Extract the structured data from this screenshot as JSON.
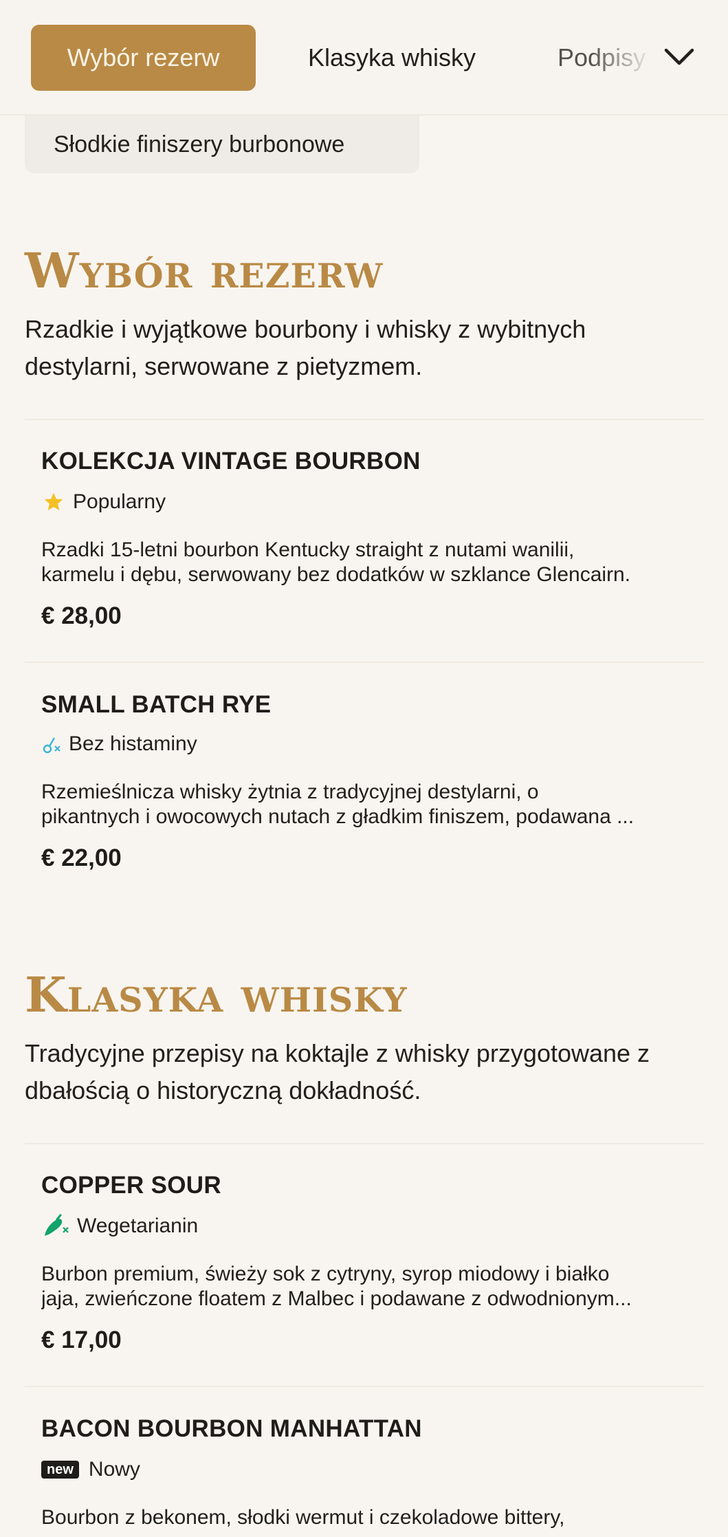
{
  "nav": {
    "tabs": [
      {
        "label": "Wybór rezerw",
        "active": true
      },
      {
        "label": "Klasyka whisky",
        "active": false
      },
      {
        "label": "Podpisy",
        "active": false
      }
    ],
    "more_icon": "chevron-down-icon"
  },
  "filter_chip": {
    "label": "Słodkie finiszery burbonowe"
  },
  "sections": [
    {
      "title": "Wybór rezerw",
      "description": "Rzadkie i wyjątkowe bourbony i whisky z wybitnych destylarni, serwowane z pietyzmem.",
      "items": [
        {
          "name": "KOLEKCJA VINTAGE BOURBON",
          "badge": {
            "icon": "star-icon",
            "label": "Popularny",
            "color": "#f4c025"
          },
          "desc_line1": "Rzadki 15-letni bourbon Kentucky straight z nutami wanilii,",
          "desc_line2": "karmelu i dębu, serwowany bez dodatków w szklance Glencairn.",
          "price": "€ 28,00"
        },
        {
          "name": "SMALL BATCH RYE",
          "badge": {
            "icon": "histamine-free-icon",
            "label": "Bez histaminy",
            "color": "#3bb5d6"
          },
          "desc_line1": "Rzemieślnicza whisky żytnia z tradycyjnej destylarni, o",
          "desc_line2": "pikantnych i owocowych nutach z gładkim finiszem, podawana ...",
          "price": "€ 22,00"
        }
      ]
    },
    {
      "title": "Klasyka whisky",
      "description": "Tradycyjne przepisy na koktajle z whisky przygotowane z dbałością o historyczną dokładność.",
      "items": [
        {
          "name": "COPPER SOUR",
          "badge": {
            "icon": "vegetarian-icon",
            "label": "Wegetarianin",
            "color": "#11a36a"
          },
          "desc_line1": "Burbon premium, świeży sok z cytryny, syrop miodowy i białko",
          "desc_line2": "jaja, zwieńczone floatem z Malbec i podawane z odwodnionym...",
          "price": "€ 17,00"
        },
        {
          "name": "BACON BOURBON MANHATTAN",
          "badge": {
            "icon": "new-tag-icon",
            "tag": "new",
            "label": "Nowy"
          },
          "desc_line1": "Bourbon z bekonem, słodki wermut i czekoladowe bittery,",
          "desc_line2": ""
        }
      ]
    }
  ],
  "colors": {
    "accent": "#b98a45",
    "background": "#f8f5f0",
    "text": "#1f1d1a"
  }
}
